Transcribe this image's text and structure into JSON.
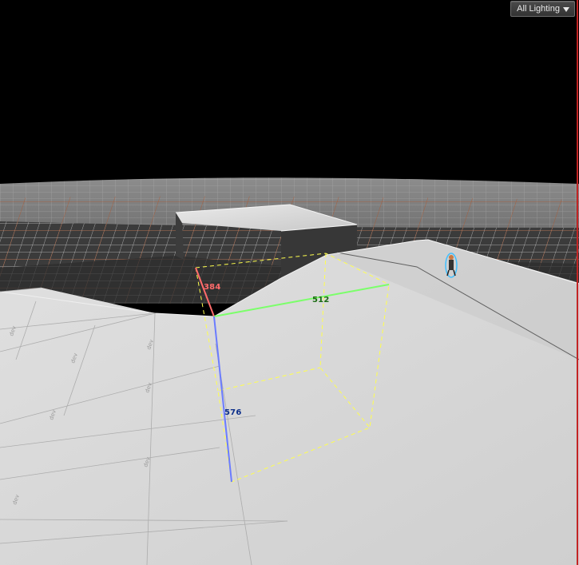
{
  "toolbar": {
    "view_mode_label": "All Lighting"
  },
  "gizmo": {
    "x_measure": "384",
    "y_measure": "512",
    "z_measure": "576"
  },
  "colors": {
    "background": "#000000",
    "floor": "#d1d1d1",
    "grid": "#ffffff",
    "grid_highlight": "#b8501f",
    "x_axis": "#ff6b6b",
    "y_axis": "#7cff6b",
    "z_axis": "#6b7cff",
    "selection": "#ffff4d",
    "viewport_border": "#c42323"
  },
  "icons": {
    "dropdown": "chevron-down-icon",
    "player_start": "player-start-icon"
  }
}
